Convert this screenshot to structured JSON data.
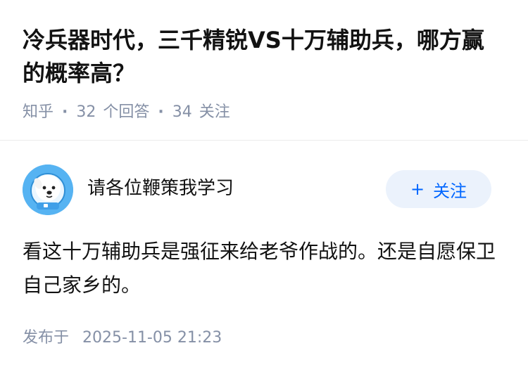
{
  "question": {
    "title": "冷兵器时代，三千精锐VS十万辅助兵，哪方赢的概率高？"
  },
  "meta": {
    "source": "知乎",
    "answers_count": "32",
    "answers_label": "个回答",
    "followers_count": "34",
    "followers_label": "关注",
    "separator": "·"
  },
  "author": {
    "name": "请各位鞭策我学习",
    "avatar_icon": "avatar-dog-astronaut-icon",
    "follow_plus": "+",
    "follow_label": "关注"
  },
  "answer": {
    "content": "看这十万辅助兵是强征来给老爷作战的。还是自愿保卫自己家乡的。",
    "publish_label": "发布于",
    "publish_time": "2025-11-05 21:23"
  },
  "colors": {
    "title_text": "#121212",
    "meta_text": "#8590a6",
    "accent_blue": "#0066ff",
    "follow_button_bg": "#ebf2fc",
    "avatar_bg": "#56b3f2"
  }
}
